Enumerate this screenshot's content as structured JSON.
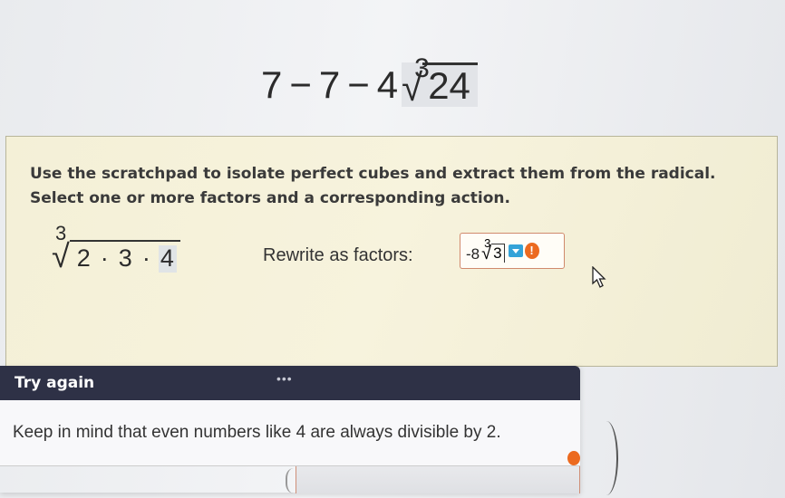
{
  "expression": {
    "term1": "7",
    "op1": "−",
    "term2": "7",
    "op2": "−",
    "coefficient": "4",
    "radical_index": "3",
    "radicand": "24"
  },
  "instructions": {
    "line1": "Use the scratchpad to isolate perfect cubes and extract them from the radical.",
    "line2": "Select one or more factors and a corresponding action."
  },
  "scratchpad": {
    "radical_index": "3",
    "factors": [
      "2",
      "3",
      "4"
    ],
    "separator": "·",
    "selected_factor_index": 2
  },
  "rewrite": {
    "label": "Rewrite as factors:",
    "answer_coefficient": "-8",
    "answer_index": "3",
    "answer_radicand": "3",
    "warning_symbol": "!"
  },
  "feedback": {
    "title": "Try again",
    "menu_dots": "•••",
    "message": "Keep in mind that even numbers like 4 are always divisible by 2."
  },
  "colors": {
    "panel_bg": "#f4f0d7",
    "feedback_header": "#2e3146",
    "dropdown_badge": "#34a3d8",
    "warning_badge": "#ec6a1f",
    "answer_border": "#d08a6d"
  },
  "icons": {
    "dropdown": "chevron-down-icon",
    "warning": "warning-icon",
    "cursor": "pointer-cursor-icon"
  }
}
